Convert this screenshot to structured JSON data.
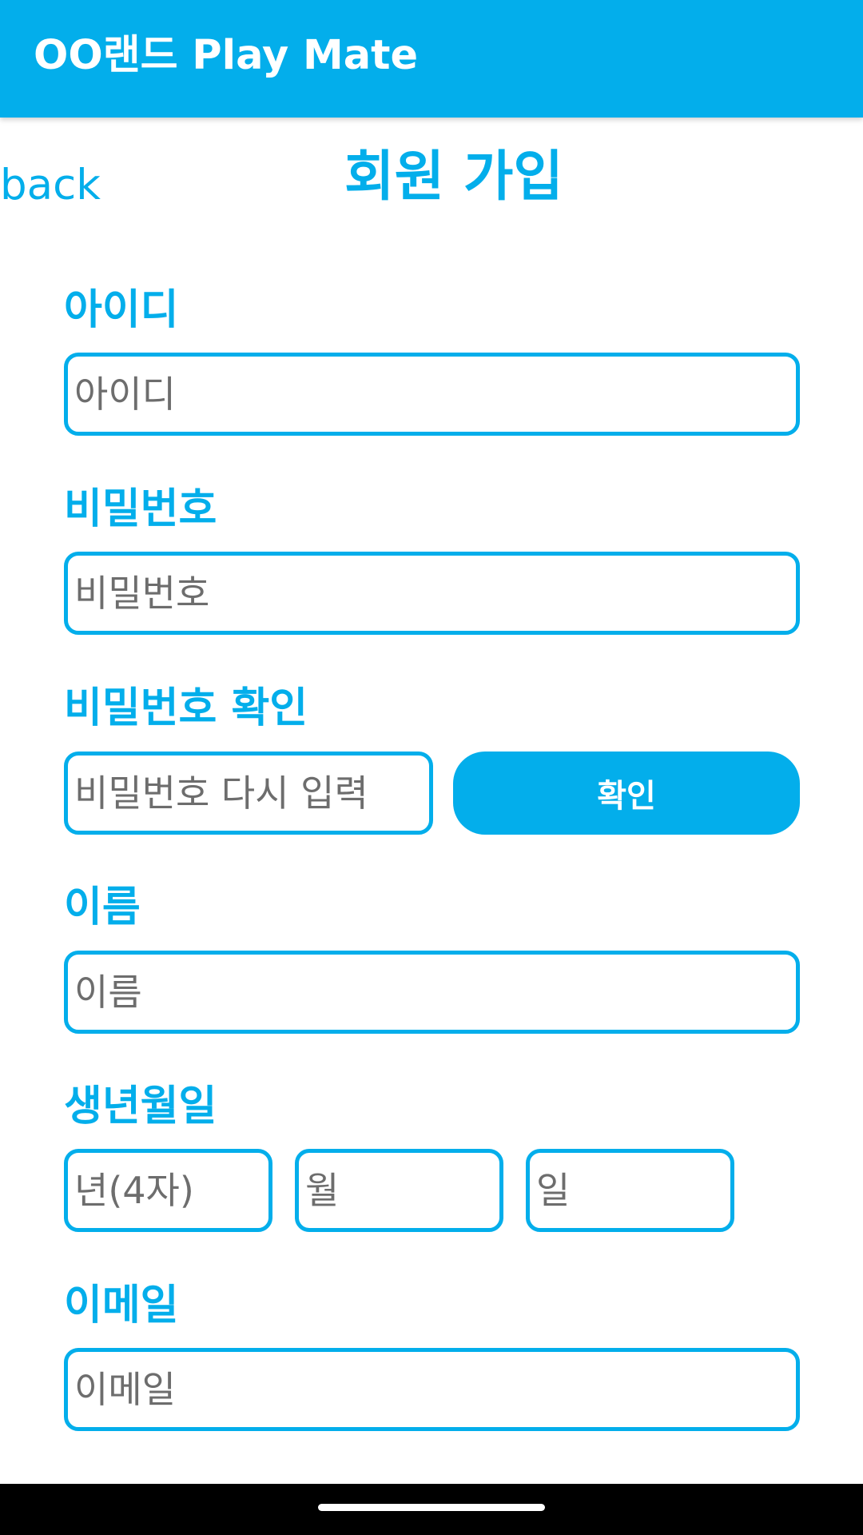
{
  "appbar": {
    "title": "OO랜드 Play Mate"
  },
  "header": {
    "back_label": "back",
    "title": "회원 가입"
  },
  "form": {
    "id": {
      "label": "아이디",
      "placeholder": "아이디"
    },
    "password": {
      "label": "비밀번호",
      "placeholder": "비밀번호"
    },
    "password_confirm": {
      "label": "비밀번호 확인",
      "placeholder": "비밀번호 다시 입력",
      "button_label": "확인"
    },
    "name": {
      "label": "이름",
      "placeholder": "이름"
    },
    "birthdate": {
      "label": "생년월일",
      "year_placeholder": "년(4자)",
      "month_placeholder": "월",
      "day_placeholder": "일"
    },
    "email": {
      "label": "이메일",
      "placeholder": "이메일"
    }
  },
  "colors": {
    "accent": "#03AEEB",
    "background": "#FFFFFF",
    "navbar": "#000000"
  }
}
